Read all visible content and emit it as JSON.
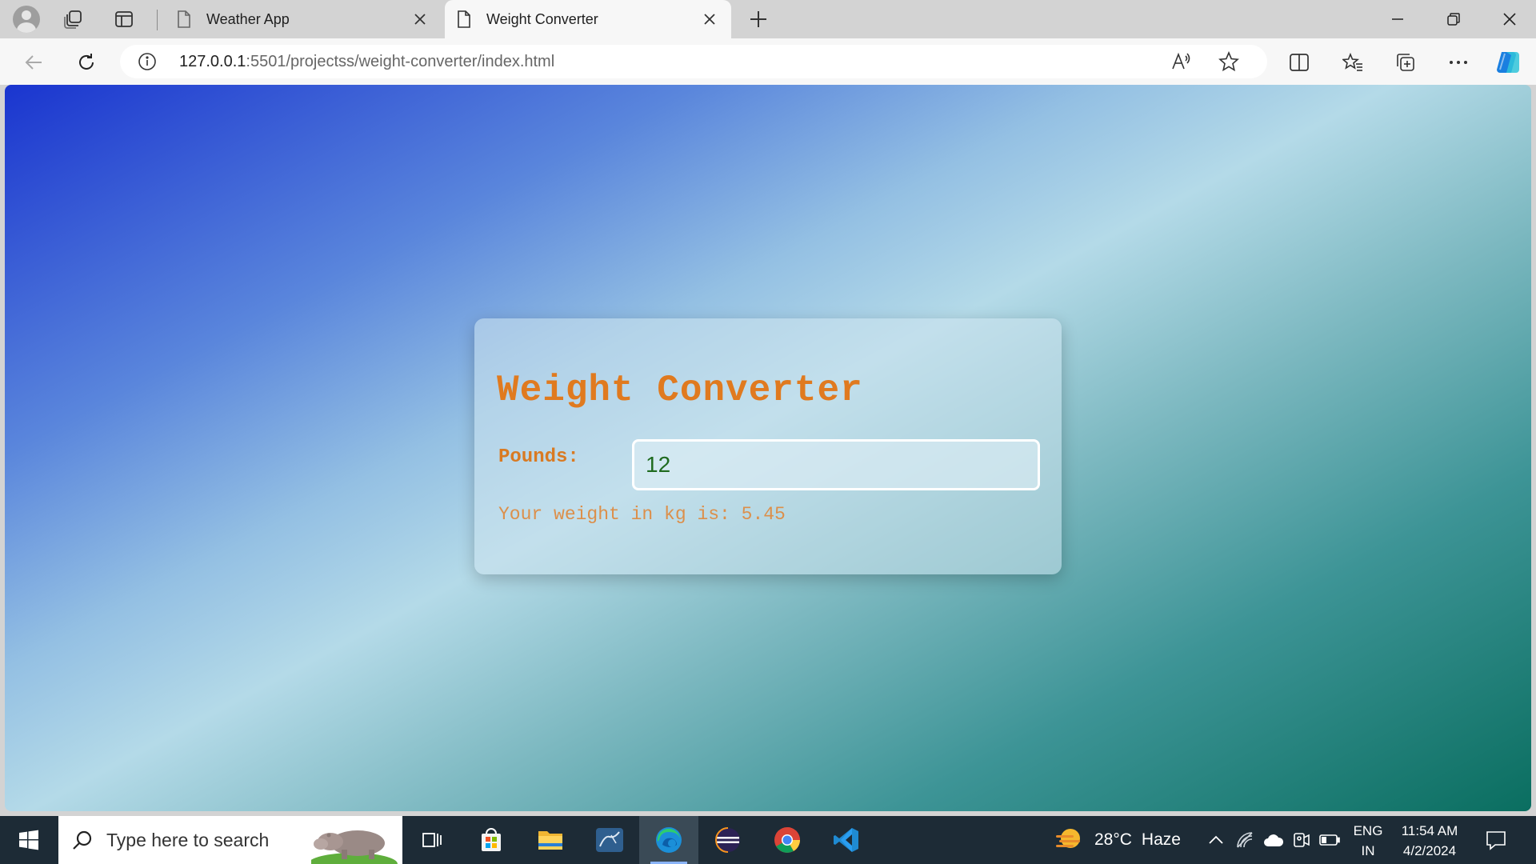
{
  "browser": {
    "tabs": [
      {
        "title": "Weather App",
        "active": false
      },
      {
        "title": "Weight Converter",
        "active": true
      }
    ],
    "address": {
      "host": "127.0.0.1",
      "path": ":5501/projectss/weight-converter/index.html"
    }
  },
  "page": {
    "title": "Weight Converter",
    "pounds_label": "Pounds:",
    "pounds_value": "12",
    "result_text": "Your weight in kg is: 5.45",
    "colors": {
      "title": "#e07a1f",
      "label": "#d97a22",
      "result": "#dc8f4a",
      "input_text": "#1f6b1f",
      "gradient_start": "#1a35cf",
      "gradient_end": "#0a6e60"
    }
  },
  "taskbar": {
    "search_placeholder": "Type here to search",
    "weather": {
      "temp": "28°C",
      "condition": "Haze"
    },
    "language": {
      "line1": "ENG",
      "line2": "IN"
    },
    "clock": {
      "time": "11:54 AM",
      "date": "4/2/2024"
    },
    "apps": [
      "task-view",
      "microsoft-store",
      "file-explorer",
      "mysql-workbench",
      "edge",
      "eclipse",
      "chrome",
      "vscode"
    ]
  }
}
